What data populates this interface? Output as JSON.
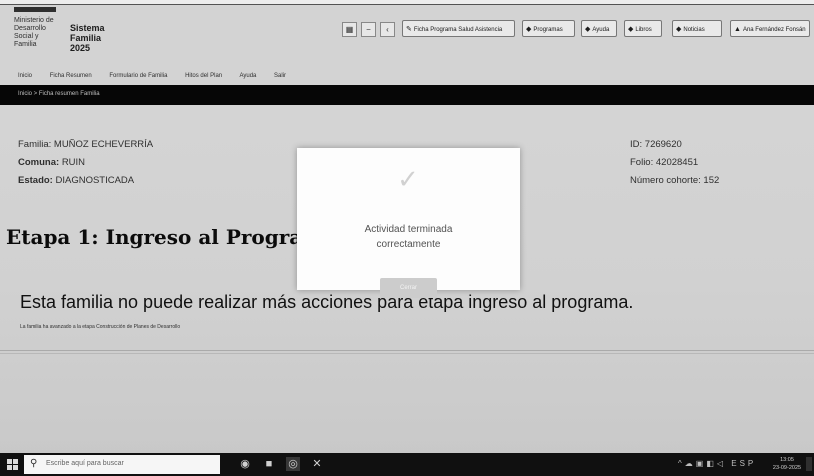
{
  "header": {
    "ministry": [
      "Ministerio de",
      "Desarrollo",
      "Social y",
      "Familia"
    ],
    "brand": [
      "Sistema",
      "Familia",
      "2025"
    ],
    "toolbar_buttons": [
      {
        "label": "Ficha Programa Salud Asistencia",
        "icon": "✎"
      },
      {
        "label": "Programas",
        "icon": "◆"
      },
      {
        "label": "Ayuda",
        "icon": "◆"
      },
      {
        "label": "Libros",
        "icon": "◆"
      },
      {
        "label": "Noticias",
        "icon": "◆"
      },
      {
        "label": "Ana Fernández Fonsán",
        "icon": "▲"
      }
    ],
    "nav": [
      "Inicio",
      "Ficha Resumen",
      "Formulario de Familia",
      "Hitos del Plan",
      "Ayuda",
      "Salir"
    ]
  },
  "breadcrumb": "Inicio > Ficha resumen Familia",
  "family": {
    "name_label": "Familia:",
    "name": "MUÑOZ ECHEVERRÍA",
    "comuna_label": "Comuna:",
    "comuna": "RUIN",
    "estado_label": "Estado:",
    "estado": "DIAGNOSTICADA",
    "id_label": "ID:",
    "id": "7269620",
    "folio_label": "Folio:",
    "folio": "42028451",
    "cohorte_label": "Número cohorte:",
    "cohorte": "152"
  },
  "stage_title": "Etapa 1: Ingreso al Programa",
  "main_message": "Esta familia no puede realizar más acciones para etapa ingreso al programa.",
  "sub_message": "La familia ha avanzado a la etapa Construcción de Planes de Desarrollo",
  "modal": {
    "icon": "check-icon",
    "line1": "Actividad terminada",
    "line2": "correctamente",
    "button": "Cerrar"
  },
  "taskbar": {
    "search_placeholder": "Escribe aquí para buscar",
    "time": "13:05",
    "date": "23-09-2025"
  }
}
